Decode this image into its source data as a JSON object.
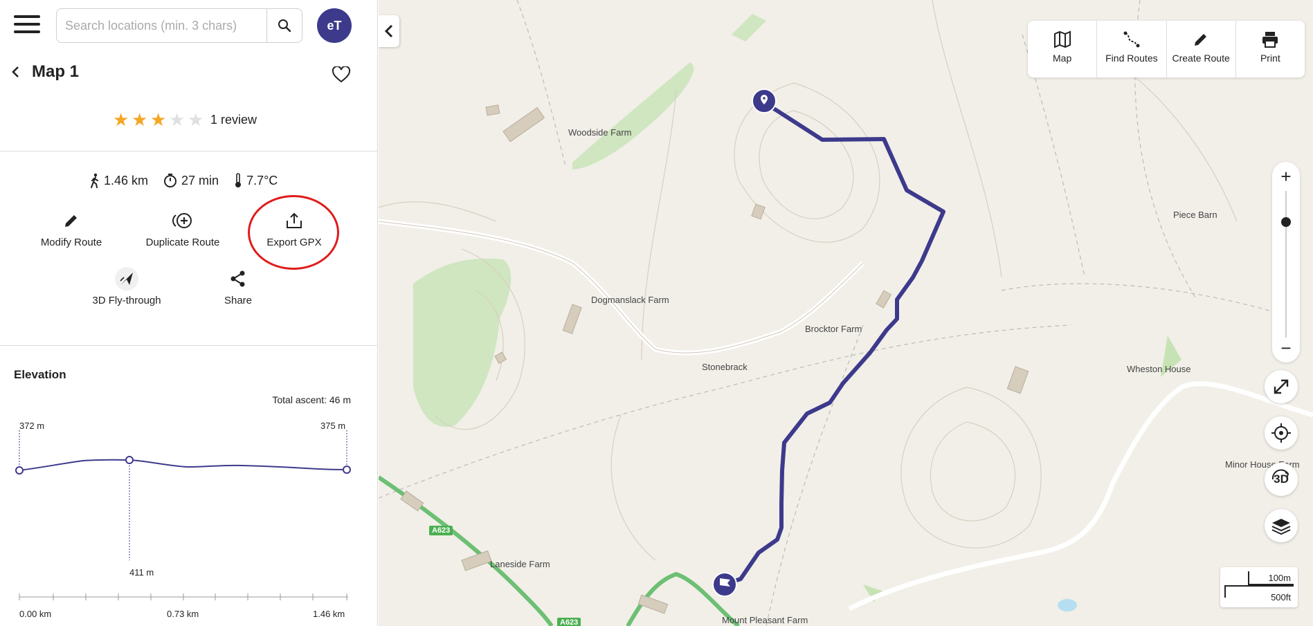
{
  "search": {
    "placeholder": "Search locations (min. 3 chars)"
  },
  "user": {
    "initials": "eT"
  },
  "route": {
    "title": "Map 1",
    "rating": 3,
    "max_rating": 5,
    "review_text": "1 review"
  },
  "stats": {
    "distance": "1.46 km",
    "duration": "27 min",
    "temperature": "7.7°C"
  },
  "actions": [
    {
      "label": "Modify Route",
      "icon": "pencil-icon"
    },
    {
      "label": "Duplicate Route",
      "icon": "duplicate-icon"
    },
    {
      "label": "Export GPX",
      "icon": "export-icon"
    },
    {
      "label": "3D Fly-through",
      "icon": "flythrough-icon"
    },
    {
      "label": "Share",
      "icon": "share-icon"
    }
  ],
  "elevation": {
    "title": "Elevation",
    "total_ascent": "Total ascent: 46 m",
    "start_label": "372 m",
    "end_label": "375 m",
    "mid_label": "411 m",
    "x_ticks": [
      "0.00 km",
      "0.73 km",
      "1.46 km"
    ]
  },
  "toolbar": [
    {
      "label": "Map",
      "icon": "map-icon"
    },
    {
      "label": "Find Routes",
      "icon": "route-icon"
    },
    {
      "label": "Create Route",
      "icon": "pencil-icon"
    },
    {
      "label": "Print",
      "icon": "printer-icon"
    }
  ],
  "map_labels": {
    "woodside": "Woodside Farm",
    "dogmanslack": "Dogmanslack Farm",
    "brocktor": "Brocktor Farm",
    "stonebrack": "Stonebrack",
    "piece_barn": "Piece Barn",
    "wheston": "Wheston House",
    "minor_house": "Minor House Farm",
    "laneside": "Laneside Farm",
    "mount_pleasant": "Mount Pleasant Farm",
    "road_a623": "A623",
    "road_a623_b": "A623"
  },
  "scale": {
    "metric": "100m",
    "imperial": "500ft"
  },
  "controls": {
    "three_d": "3D",
    "zoom_in": "+",
    "zoom_out": "−"
  },
  "colors": {
    "route": "#3d3a8c",
    "accent": "#3d3a8c",
    "star": "#f5a623",
    "highlight": "#e01b1b"
  }
}
